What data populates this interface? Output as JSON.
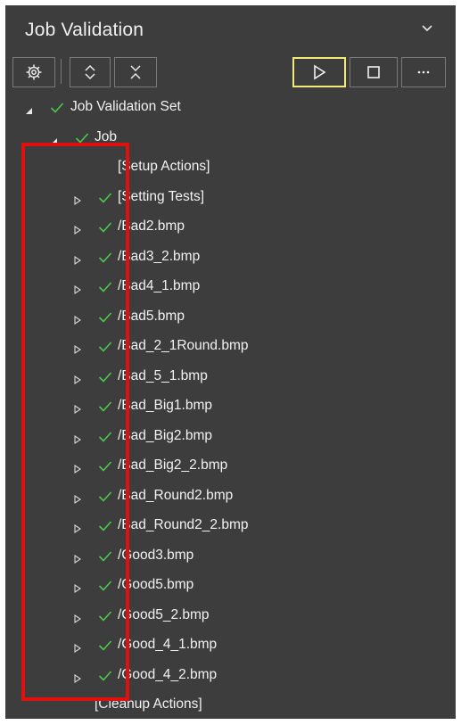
{
  "header": {
    "title": "Job Validation"
  },
  "toolbar": {
    "buttons": [
      "settings-gear",
      "expand-all",
      "collapse-all",
      "run",
      "stop",
      "more"
    ]
  },
  "tree": {
    "root": "Job Validation Set",
    "job": "Job",
    "setup": "[Setup Actions]",
    "items": [
      "[Setting Tests]",
      "/Bad2.bmp",
      "/Bad3_2.bmp",
      "/Bad4_1.bmp",
      "/Bad5.bmp",
      "/Bad_2_1Round.bmp",
      "/Bad_5_1.bmp",
      "/Bad_Big1.bmp",
      "/Bad_Big2.bmp",
      "/Bad_Big2_2.bmp",
      "/Bad_Round2.bmp",
      "/Bad_Round2_2.bmp",
      "/Good3.bmp",
      "/Good5.bmp",
      "/Good5_2.bmp",
      "/Good_4_1.bmp",
      "/Good_4_2.bmp"
    ],
    "cleanup": "[Cleanup Actions]"
  },
  "colors": {
    "panel": "#3d3d3d",
    "check": "#4ac94a",
    "run_highlight": "#f1e97a",
    "annotation": "#e0100f"
  }
}
